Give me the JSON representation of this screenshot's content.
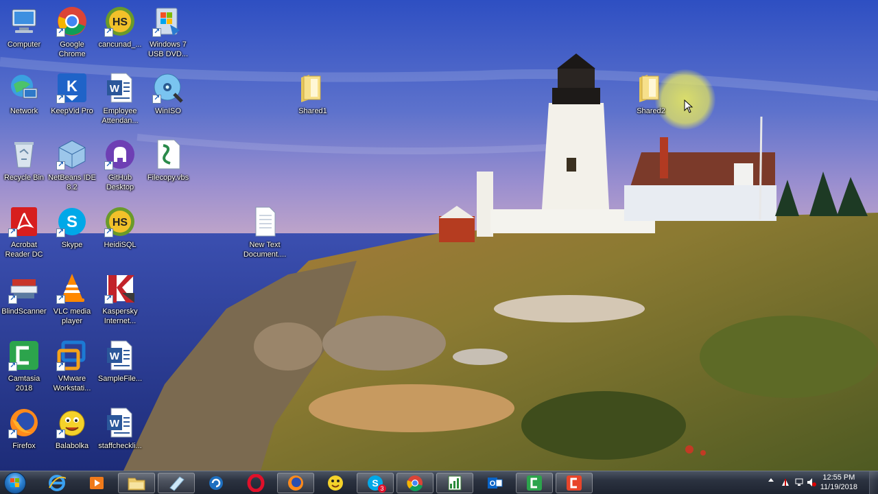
{
  "desktop": {
    "icons": [
      {
        "label": "Computer",
        "glyph": "computer-icon"
      },
      {
        "label": "Google\nChrome",
        "glyph": "chrome-icon"
      },
      {
        "label": "cancunad_...",
        "glyph": "heidisql-icon"
      },
      {
        "label": "Windows 7\nUSB DVD...",
        "glyph": "windows-usb-dvd-icon"
      },
      {
        "label": "Network",
        "glyph": "network-icon"
      },
      {
        "label": "KeepVid Pro",
        "glyph": "keepvid-icon"
      },
      {
        "label": "Employee\nAttendan...",
        "glyph": "word-document-icon"
      },
      {
        "label": "WinISO",
        "glyph": "winiso-icon"
      },
      {
        "label": "Recycle Bin",
        "glyph": "recycle-bin-icon"
      },
      {
        "label": "NetBeans IDE\n8.2",
        "glyph": "netbeans-icon"
      },
      {
        "label": "GitHub\nDesktop",
        "glyph": "github-icon"
      },
      {
        "label": "Filecopy.vbs",
        "glyph": "vbs-script-icon"
      },
      {
        "label": "Acrobat\nReader DC",
        "glyph": "acrobat-icon"
      },
      {
        "label": "Skype",
        "glyph": "skype-icon"
      },
      {
        "label": "HeidiSQL",
        "glyph": "heidisql-icon"
      },
      {
        "label": "BlindScanner",
        "glyph": "blindscanner-icon"
      },
      {
        "label": "VLC media\nplayer",
        "glyph": "vlc-icon"
      },
      {
        "label": "Kaspersky\nInternet...",
        "glyph": "kaspersky-icon"
      },
      {
        "label": "Camtasia\n2018",
        "glyph": "camtasia-icon"
      },
      {
        "label": "VMware\nWorkstati...",
        "glyph": "vmware-icon"
      },
      {
        "label": "SampleFile...",
        "glyph": "word-document-icon"
      },
      {
        "label": "Firefox",
        "glyph": "firefox-icon"
      },
      {
        "label": "Balabolka",
        "glyph": "balabolka-icon"
      },
      {
        "label": "staffcheckli...",
        "glyph": "word-document-icon"
      },
      {
        "label": "Shared1",
        "glyph": "folder-icon"
      },
      {
        "label": "New Text\nDocument....",
        "glyph": "text-document-icon"
      },
      {
        "label": "Shared2",
        "glyph": "folder-icon"
      }
    ]
  },
  "taskbar": {
    "start": "start-orb",
    "pinned": [
      "internet-explorer-icon",
      "media-player-icon",
      "file-explorer-icon",
      "notes-icon",
      "sync-icon",
      "opera-icon",
      "firefox-icon",
      "balabolka-icon",
      "skype-icon",
      "chrome-icon",
      "excel-icon",
      "outlook-icon",
      "camtasia-icon",
      "camtasia-recorder-icon"
    ],
    "skype_badge": "3",
    "tray_icons": [
      "show-hidden-icons",
      "action-center-icon",
      "network-tray-icon",
      "volume-muted-icon"
    ],
    "clock_time": "12:55 PM",
    "clock_date": "11/19/2018"
  },
  "colors": {
    "sky_top": "#3a5fc8",
    "sea": "#2d4aa0",
    "grass": "#8a7a2a",
    "lighthouse": "#f2f2ee",
    "taskbar": "#2b3240"
  }
}
